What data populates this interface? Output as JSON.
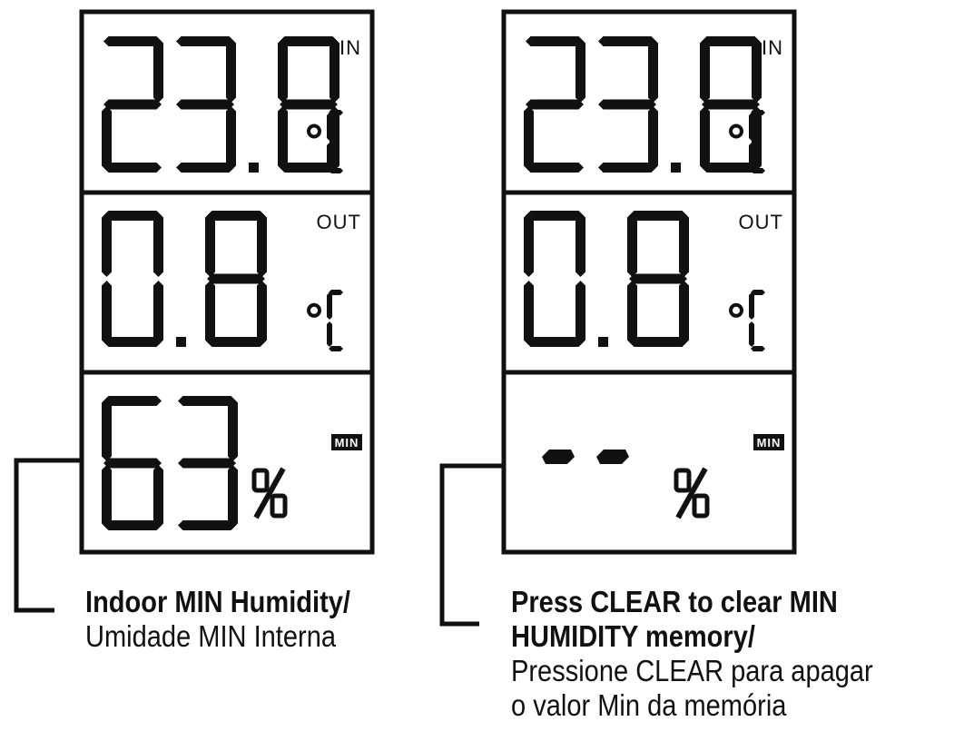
{
  "panels": [
    {
      "indoor": {
        "value": "23.8",
        "unit": "°C",
        "label": "IN"
      },
      "outdoor": {
        "value": "0.8",
        "unit": "°C",
        "label": "OUT"
      },
      "humidity": {
        "value": "63",
        "unit": "%",
        "badge": "MIN"
      }
    },
    {
      "indoor": {
        "value": "23.8",
        "unit": "°C",
        "label": "IN"
      },
      "outdoor": {
        "value": "0.8",
        "unit": "°C",
        "label": "OUT"
      },
      "humidity": {
        "value": "--",
        "unit": "%",
        "badge": "MIN"
      }
    }
  ],
  "captions": {
    "left": {
      "bold": "Indoor MIN Humidity/",
      "normal": "Umidade MIN Interna"
    },
    "right": {
      "bold_line1": "Press CLEAR to clear MIN",
      "bold_line2": "HUMIDITY memory/",
      "normal_line1": "Pressione CLEAR para apagar",
      "normal_line2": "o valor Min da memória"
    }
  }
}
